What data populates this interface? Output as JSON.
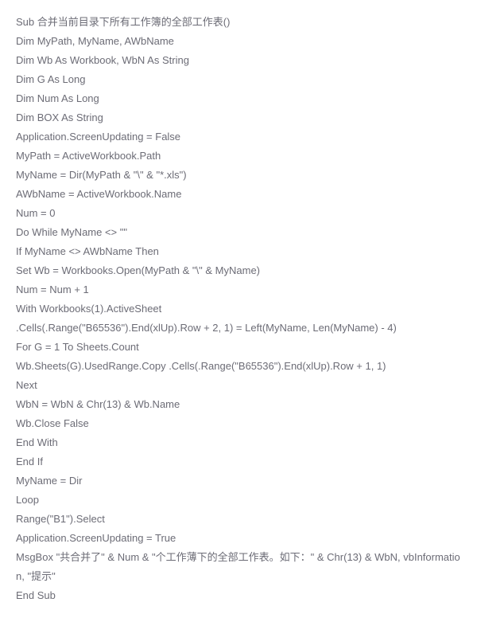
{
  "code": {
    "lines": [
      "Sub 合并当前目录下所有工作簿的全部工作表()",
      "Dim MyPath, MyName, AWbName",
      "Dim Wb As Workbook, WbN As String",
      "Dim G As Long",
      "Dim Num As Long",
      "Dim BOX As String",
      "Application.ScreenUpdating = False",
      "MyPath = ActiveWorkbook.Path",
      "MyName = Dir(MyPath & \"\\\" & \"*.xls\")",
      "AWbName = ActiveWorkbook.Name",
      "Num = 0",
      "Do While MyName <> \"\"",
      "If MyName <> AWbName Then",
      "Set Wb = Workbooks.Open(MyPath & \"\\\" & MyName)",
      "Num = Num + 1",
      "With Workbooks(1).ActiveSheet",
      ".Cells(.Range(\"B65536\").End(xlUp).Row + 2, 1) = Left(MyName, Len(MyName) - 4)",
      "For G = 1 To Sheets.Count",
      "Wb.Sheets(G).UsedRange.Copy .Cells(.Range(\"B65536\").End(xlUp).Row + 1, 1)",
      "Next",
      "WbN = WbN & Chr(13) & Wb.Name",
      "Wb.Close False",
      "End With",
      "End If",
      "MyName = Dir",
      "Loop",
      "Range(\"B1\").Select",
      "Application.ScreenUpdating = True",
      "MsgBox \"共合并了\" & Num & \"个工作薄下的全部工作表。如下：\" & Chr(13) & WbN, vbInformation, \"提示\"",
      "End Sub"
    ]
  }
}
